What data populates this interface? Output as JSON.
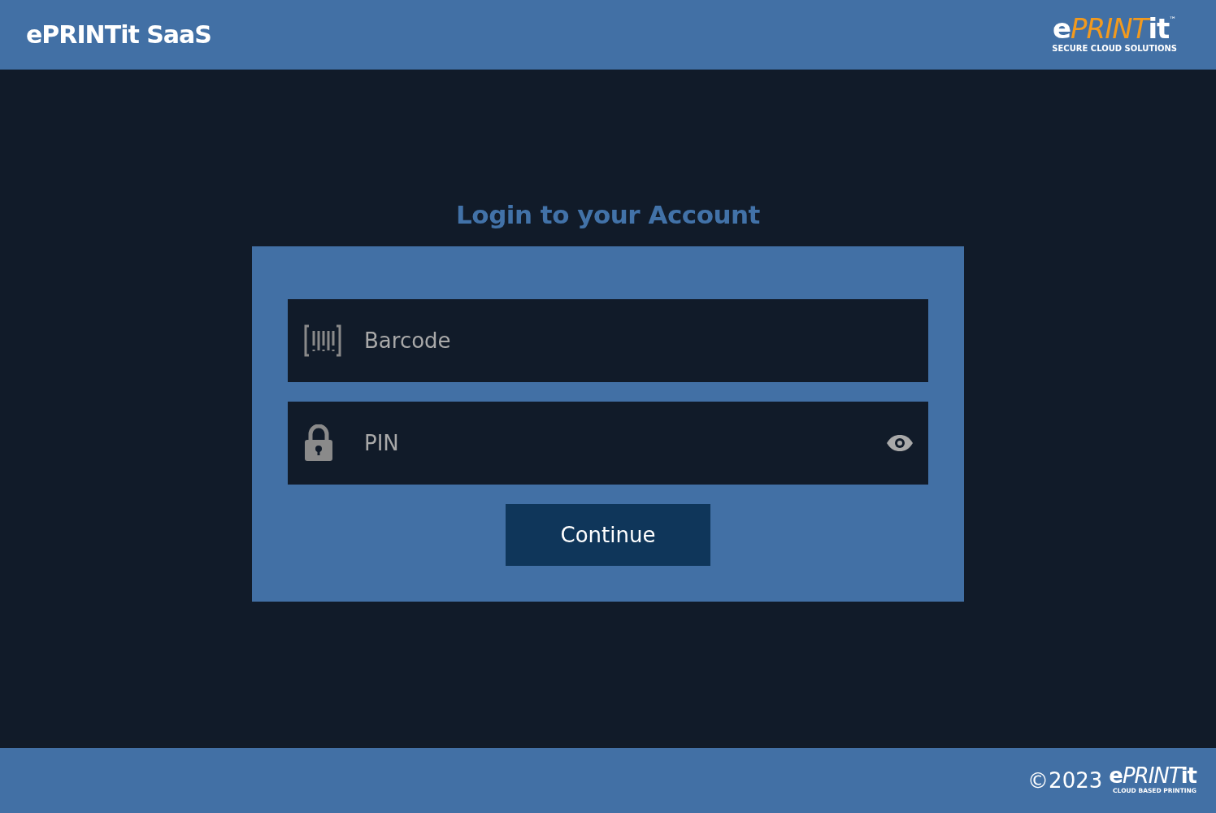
{
  "header": {
    "title": "ePRINTit SaaS",
    "logo": [
      {
        "text": "e",
        "color": "#ffffff"
      },
      {
        "text": "PRINT",
        "color": "#f29a1e"
      },
      {
        "text": "it",
        "color": "#ffffff"
      }
    ],
    "trademark": "™",
    "tagline": "SECURE CLOUD SOLUTIONS"
  },
  "login": {
    "heading": "Login to your Account",
    "fields": [
      {
        "kind": "barcode",
        "placeholder": "Barcode"
      },
      {
        "kind": "pin",
        "placeholder": "PIN"
      }
    ],
    "button": "Continue"
  },
  "footer": {
    "copyright": "©2023",
    "logo": [
      {
        "text": "e",
        "color": "#ffffff"
      },
      {
        "text": "PRINT",
        "color": "#ffffff"
      },
      {
        "text": "it",
        "color": "#ffffff"
      }
    ],
    "tagline": "CLOUD BASED PRINTING"
  }
}
